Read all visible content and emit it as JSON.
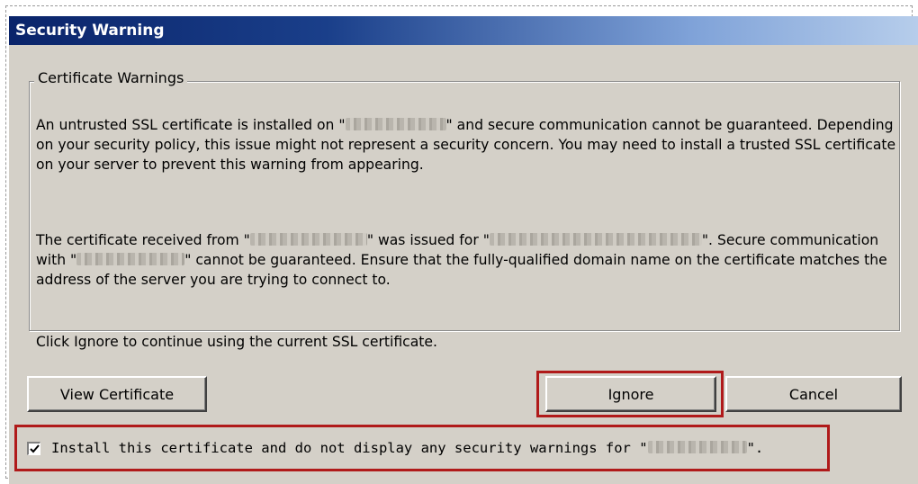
{
  "dialog": {
    "title": "Security Warning",
    "group_title": "Certificate Warnings",
    "paragraph1": {
      "before": "An untrusted SSL certificate is installed on \"",
      "after": "\" and secure communication cannot be guaranteed.  Depending on your security policy, this issue might not represent a security concern.  You may need to install a trusted SSL certificate on your server to prevent this warning from appearing."
    },
    "paragraph2": {
      "part1": "The certificate received from \"",
      "part2": "\" was issued for \"",
      "part3": "\".  Secure communication with \"",
      "part4": "\" cannot be guaranteed.  Ensure that the fully-qualified domain name on the certificate matches the address of the server you are trying to connect to."
    },
    "hint": "Click Ignore to continue using the current SSL certificate.",
    "buttons": {
      "view_certificate": "View Certificate",
      "ignore": "Ignore",
      "cancel": "Cancel"
    },
    "checkbox": {
      "checked": true,
      "label_before": "Install this certificate and do not display any security warnings for \"",
      "label_after": "\"."
    }
  },
  "colors": {
    "highlight": "#b01a1a",
    "titlebar_start": "#0a246a",
    "titlebar_end": "#b6cdeb",
    "dialog_bg": "#d4d0c8"
  }
}
